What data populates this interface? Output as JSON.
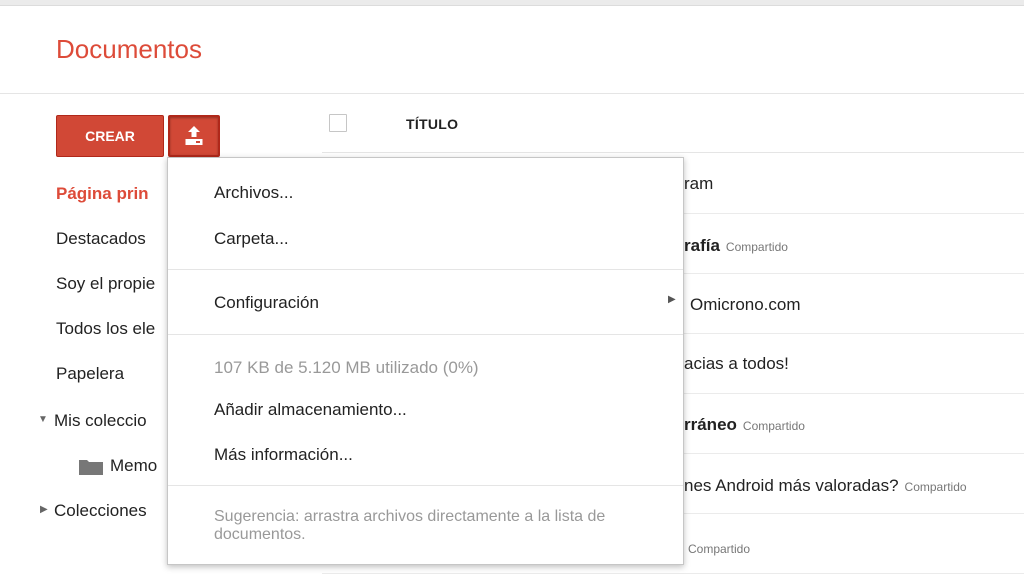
{
  "header": {
    "title": "Documentos"
  },
  "toolbar": {
    "create_label": "CREAR"
  },
  "sidebar": {
    "items": [
      {
        "label": "Página prin"
      },
      {
        "label": "Destacados"
      },
      {
        "label": "Soy el propie"
      },
      {
        "label": "Todos los ele"
      },
      {
        "label": "Papelera"
      },
      {
        "label": "Mis coleccio"
      },
      {
        "label": "Memo"
      },
      {
        "label": "Colecciones"
      }
    ]
  },
  "list": {
    "column_title": "TÍTULO",
    "rows": [
      {
        "text": "ram",
        "shared": ""
      },
      {
        "text": "rafía",
        "shared": "Compartido"
      },
      {
        "text": "Omicrono.com",
        "shared": ""
      },
      {
        "text": "acias a todos!",
        "shared": ""
      },
      {
        "text": "rráneo",
        "shared": "Compartido"
      },
      {
        "text": "nes Android más valoradas?",
        "shared": "Compartido"
      },
      {
        "text": "",
        "shared": "Compartido"
      }
    ]
  },
  "upload_menu": {
    "files": "Archivos...",
    "folder": "Carpeta...",
    "settings": "Configuración",
    "storage_usage": "107 KB de 5.120 MB utilizado (0%)",
    "add_storage": "Añadir almacenamiento...",
    "more_info": "Más información...",
    "tip": "Sugerencia: arrastra archivos directamente a la lista de documentos."
  },
  "colors": {
    "accent": "#dd4b39",
    "button": "#d14836"
  }
}
